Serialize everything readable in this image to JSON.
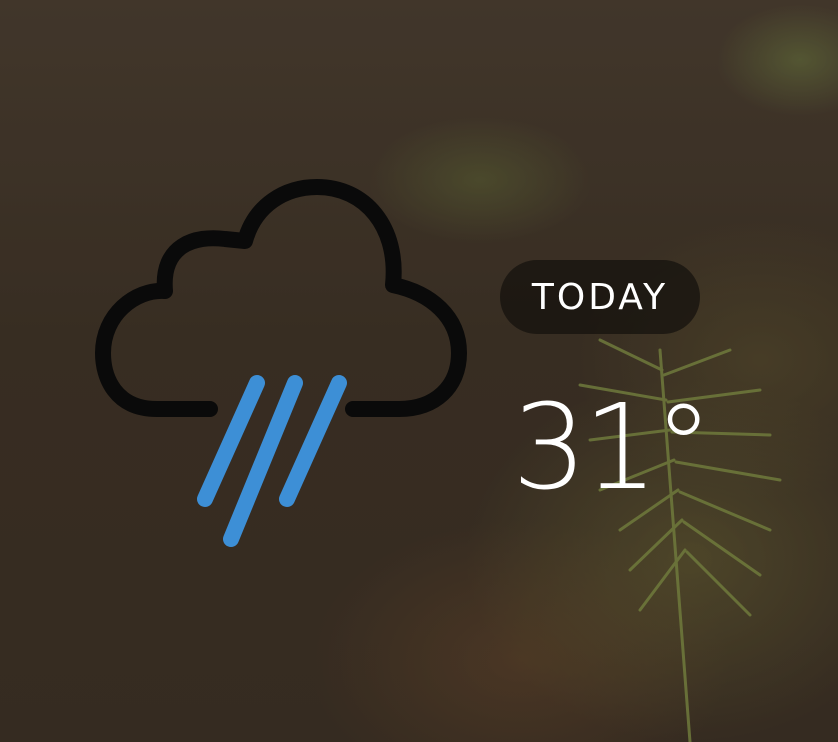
{
  "widget": {
    "day_label": "TODAY",
    "temperature": "31°",
    "condition_icon": "rain-cloud-icon"
  },
  "colors": {
    "cloud_outline": "#0a0a0a",
    "rain": "#3d8fd6",
    "pill_background": "#14100c",
    "text": "#ffffff"
  }
}
